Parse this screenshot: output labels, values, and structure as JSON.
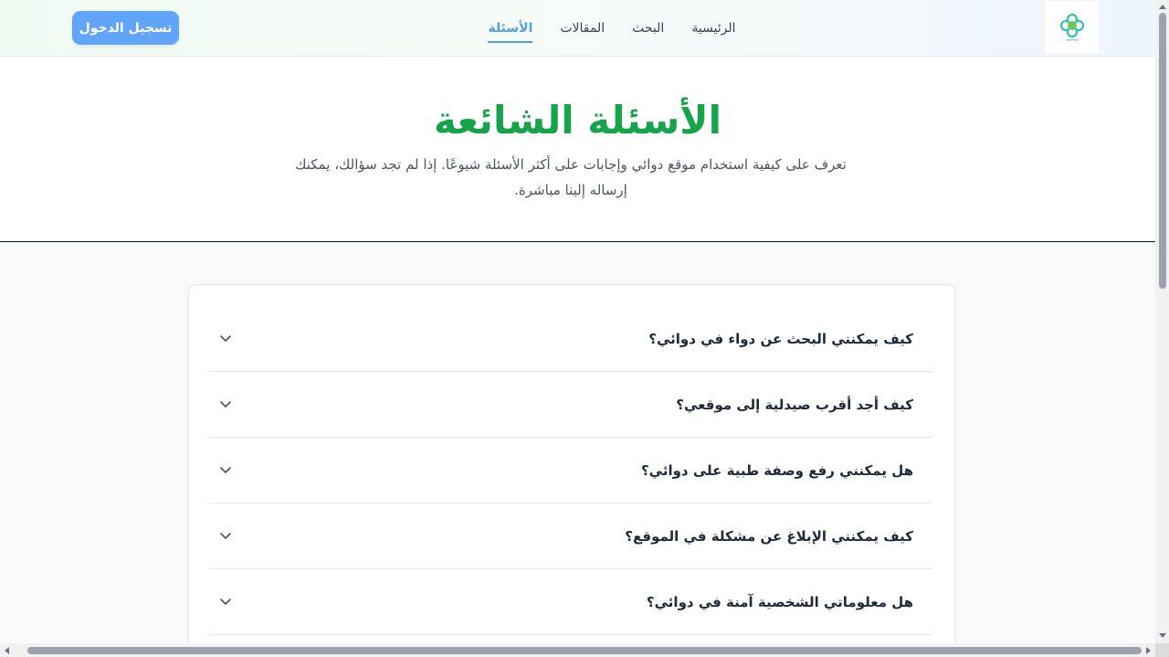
{
  "header": {
    "logo_icon": "medical-cross-logo",
    "nav": [
      {
        "label": "الرئيسية",
        "active": false
      },
      {
        "label": "البحث",
        "active": false
      },
      {
        "label": "المقالات",
        "active": false
      },
      {
        "label": "الأسئلة",
        "active": true
      }
    ],
    "login_label": "تسجيل الدخول"
  },
  "hero": {
    "title": "الأسئلة الشائعة",
    "description": "تعرف على كيفية استخدام موقع دوائي وإجابات على أكثر الأسئلة شيوعًا. إذا لم تجد سؤالك، يمكنك إرساله إلينا مباشرة."
  },
  "faq": {
    "items": [
      {
        "question": "كيف يمكنني البحث عن دواء في دوائي؟"
      },
      {
        "question": "كيف أجد أقرب صيدلية إلى موقعي؟"
      },
      {
        "question": "هل يمكنني رفع وصفة طبية على دوائي؟"
      },
      {
        "question": "كيف يمكنني الإبلاغ عن مشكلة في الموقع؟"
      },
      {
        "question": "هل معلوماتي الشخصية آمنة في دوائي؟"
      }
    ]
  },
  "colors": {
    "accent_green": "#16a34a",
    "accent_blue": "#60a5fa",
    "nav_active": "#4ea3e0"
  }
}
